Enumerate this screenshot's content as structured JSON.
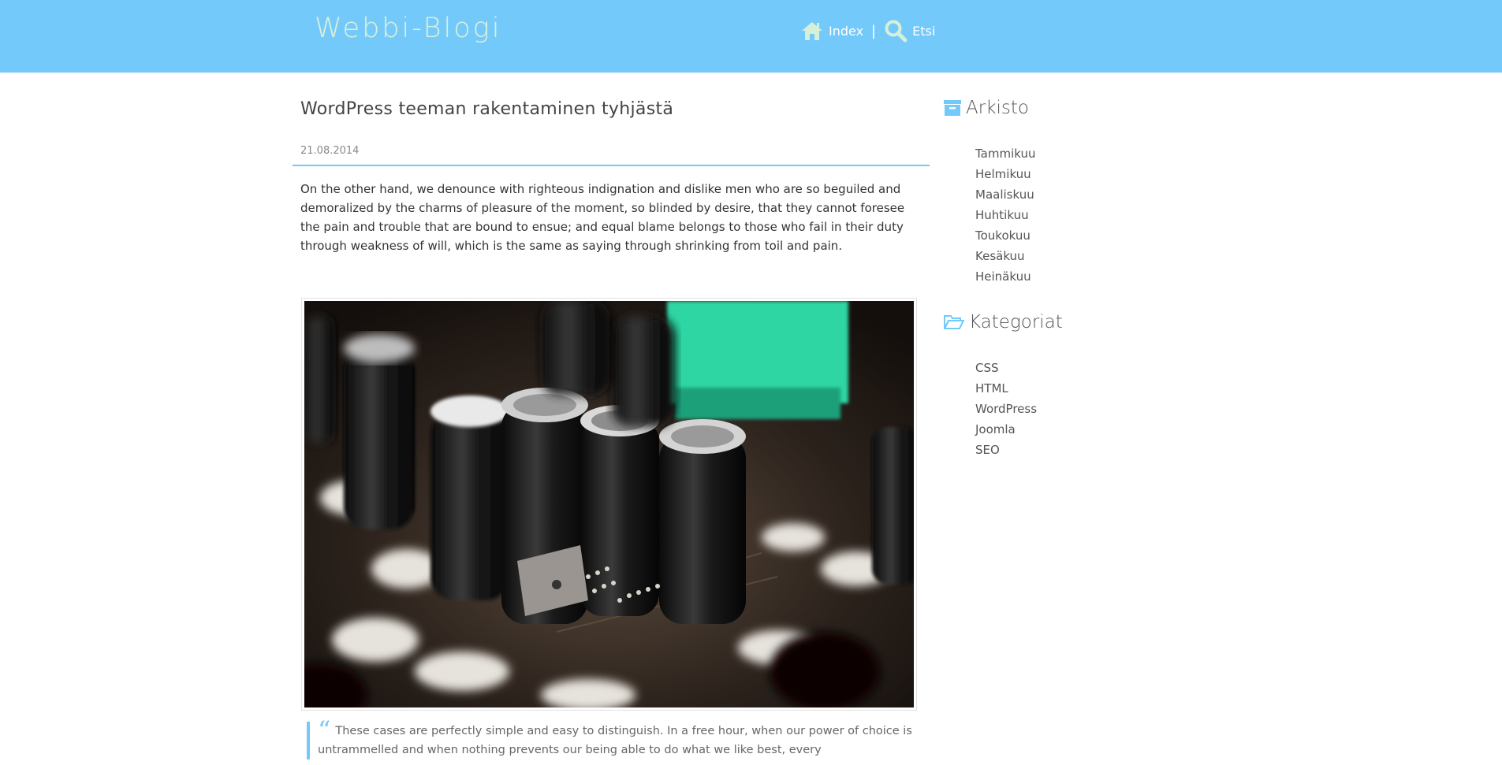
{
  "header": {
    "site_title": "Webbi-Blogi",
    "nav": [
      {
        "label": "Index",
        "icon": "home-icon"
      },
      {
        "label": "Etsi",
        "icon": "search-icon"
      }
    ],
    "separator": "|",
    "background_color": "#74c9fb"
  },
  "post": {
    "title": "WordPress teeman rakentaminen tyhjästä",
    "date": "21.08.2014",
    "body": "On the other hand, we denounce with righteous indignation and dislike men who are so beguiled and demoralized by the charms of pleasure of the moment, so blinded by desire, that they cannot foresee the pain and trouble that are bound to ensue; and equal blame belongs to those who fail in their duty through weakness of will, which is the same as saying through shrinking from toil and pain.",
    "image_subject": "close-up of a circuit board with capacitors",
    "quote_mark": "“",
    "quote": "These cases are perfectly simple and easy to distinguish. In a free hour, when our power of choice is untrammelled and when nothing prevents our being able to do what we like best, every"
  },
  "sidebar": {
    "archive": {
      "title": "Arkisto",
      "icon": "archive-icon",
      "items": [
        "Tammikuu",
        "Helmikuu",
        "Maaliskuu",
        "Huhtikuu",
        "Toukokuu",
        "Kesäkuu",
        "Heinäkuu"
      ]
    },
    "categories": {
      "title": "Kategoriat",
      "icon": "folder-open-icon",
      "items": [
        "CSS",
        "HTML",
        "WordPress",
        "Joomla",
        "SEO"
      ]
    }
  },
  "colors": {
    "accent": "#74c9fb"
  }
}
